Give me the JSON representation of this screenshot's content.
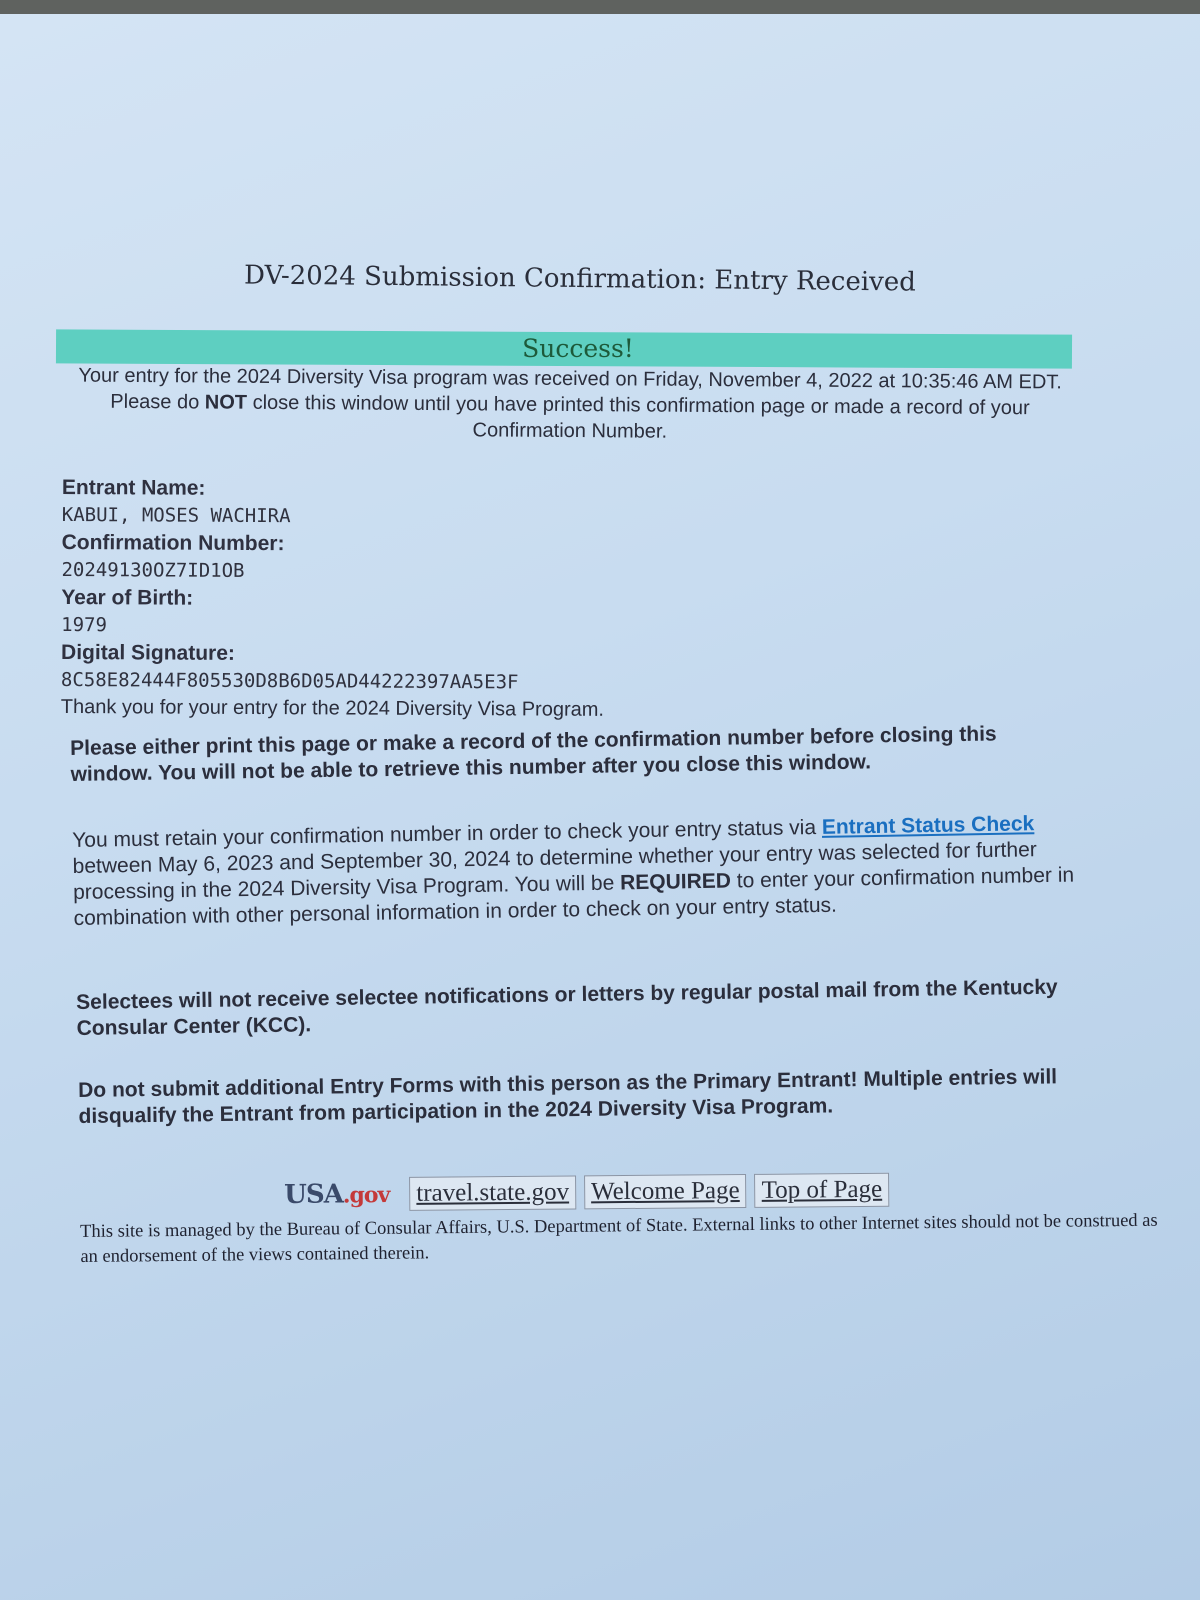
{
  "document": {
    "title": "DV-2024 Submission Confirmation: Entry Received",
    "success_label": "Success!",
    "intro": {
      "line_pre": "Your entry for the 2024 Diversity Visa program was received on Friday, November 4, 2022 at 10:35:46 AM EDT. Please do ",
      "line_bold": "NOT",
      "line_post": " close this window until you have printed this confirmation page or made a record of your Confirmation Number."
    },
    "fields": [
      {
        "label": "Entrant Name:",
        "value": "KABUI, MOSES WACHIRA"
      },
      {
        "label": "Confirmation Number:",
        "value": "20249130OZ7ID1OB"
      },
      {
        "label": "Year of Birth:",
        "value": "1979"
      },
      {
        "label": "Digital Signature:",
        "value": "8C58E82444F805530D8B6D05AD44222397AA5E3F"
      }
    ],
    "thanks": "Thank you for your entry for the 2024 Diversity Visa Program.",
    "print_notice": "Please either print this page or make a record of the confirmation number before closing this window. You will not be able to retrieve this number after you close this window.",
    "status_paragraph": {
      "pre": "You must retain your confirmation number in order to check your entry status via ",
      "link": "Entrant Status Check",
      "mid": " between May 6, 2023 and September 30, 2024 to determine whether your entry was selected for further processing in the 2024 Diversity Visa Program. You will be ",
      "bold": "REQUIRED",
      "post": " to enter your confirmation number in combination with other personal information in order to check on your entry status."
    },
    "selectees_notice": "Selectees will not receive selectee notifications or letters by regular postal mail from the Kentucky Consular Center (KCC).",
    "multiple_entries_notice": "Do not submit additional Entry Forms with this person as the Primary Entrant! Multiple entries will disqualify the Entrant from participation in the 2024 Diversity Visa Program."
  },
  "footer": {
    "logo": {
      "usa": "USA",
      "gov": ".gov"
    },
    "links": [
      "travel.state.gov",
      "Welcome Page",
      "Top of Page"
    ],
    "disclaimer": "This site is managed by the Bureau of Consular Affairs, U.S. Department of State. External links to other Internet sites should not be construed as an endorsement of the views contained therein."
  },
  "colors": {
    "paper": "#c8dcf0",
    "success_bar": "#5ecfc1",
    "link": "#1a6fc0"
  }
}
